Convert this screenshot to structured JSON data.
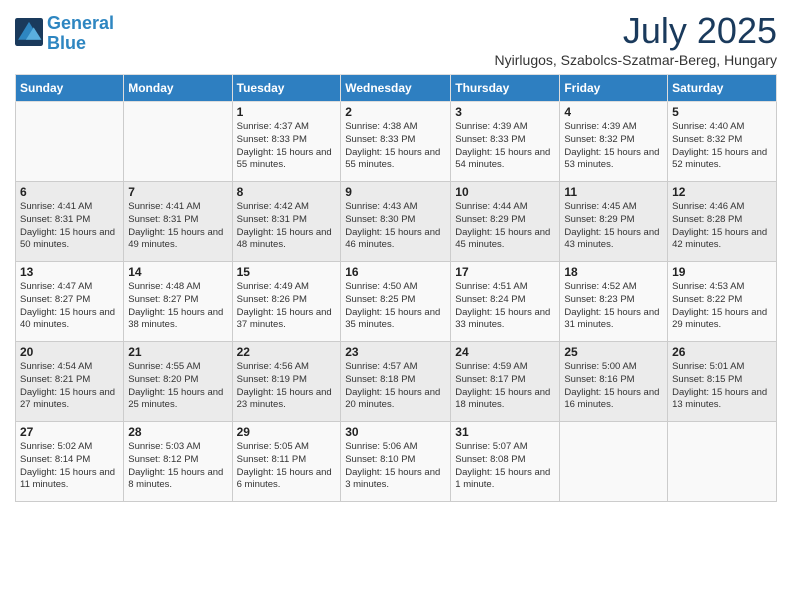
{
  "logo": {
    "line1": "General",
    "line2": "Blue"
  },
  "title": "July 2025",
  "location": "Nyirlugos, Szabolcs-Szatmar-Bereg, Hungary",
  "days_of_week": [
    "Sunday",
    "Monday",
    "Tuesday",
    "Wednesday",
    "Thursday",
    "Friday",
    "Saturday"
  ],
  "weeks": [
    [
      {
        "day": "",
        "sunrise": "",
        "sunset": "",
        "daylight": ""
      },
      {
        "day": "",
        "sunrise": "",
        "sunset": "",
        "daylight": ""
      },
      {
        "day": "1",
        "sunrise": "Sunrise: 4:37 AM",
        "sunset": "Sunset: 8:33 PM",
        "daylight": "Daylight: 15 hours and 55 minutes."
      },
      {
        "day": "2",
        "sunrise": "Sunrise: 4:38 AM",
        "sunset": "Sunset: 8:33 PM",
        "daylight": "Daylight: 15 hours and 55 minutes."
      },
      {
        "day": "3",
        "sunrise": "Sunrise: 4:39 AM",
        "sunset": "Sunset: 8:33 PM",
        "daylight": "Daylight: 15 hours and 54 minutes."
      },
      {
        "day": "4",
        "sunrise": "Sunrise: 4:39 AM",
        "sunset": "Sunset: 8:32 PM",
        "daylight": "Daylight: 15 hours and 53 minutes."
      },
      {
        "day": "5",
        "sunrise": "Sunrise: 4:40 AM",
        "sunset": "Sunset: 8:32 PM",
        "daylight": "Daylight: 15 hours and 52 minutes."
      }
    ],
    [
      {
        "day": "6",
        "sunrise": "Sunrise: 4:41 AM",
        "sunset": "Sunset: 8:31 PM",
        "daylight": "Daylight: 15 hours and 50 minutes."
      },
      {
        "day": "7",
        "sunrise": "Sunrise: 4:41 AM",
        "sunset": "Sunset: 8:31 PM",
        "daylight": "Daylight: 15 hours and 49 minutes."
      },
      {
        "day": "8",
        "sunrise": "Sunrise: 4:42 AM",
        "sunset": "Sunset: 8:31 PM",
        "daylight": "Daylight: 15 hours and 48 minutes."
      },
      {
        "day": "9",
        "sunrise": "Sunrise: 4:43 AM",
        "sunset": "Sunset: 8:30 PM",
        "daylight": "Daylight: 15 hours and 46 minutes."
      },
      {
        "day": "10",
        "sunrise": "Sunrise: 4:44 AM",
        "sunset": "Sunset: 8:29 PM",
        "daylight": "Daylight: 15 hours and 45 minutes."
      },
      {
        "day": "11",
        "sunrise": "Sunrise: 4:45 AM",
        "sunset": "Sunset: 8:29 PM",
        "daylight": "Daylight: 15 hours and 43 minutes."
      },
      {
        "day": "12",
        "sunrise": "Sunrise: 4:46 AM",
        "sunset": "Sunset: 8:28 PM",
        "daylight": "Daylight: 15 hours and 42 minutes."
      }
    ],
    [
      {
        "day": "13",
        "sunrise": "Sunrise: 4:47 AM",
        "sunset": "Sunset: 8:27 PM",
        "daylight": "Daylight: 15 hours and 40 minutes."
      },
      {
        "day": "14",
        "sunrise": "Sunrise: 4:48 AM",
        "sunset": "Sunset: 8:27 PM",
        "daylight": "Daylight: 15 hours and 38 minutes."
      },
      {
        "day": "15",
        "sunrise": "Sunrise: 4:49 AM",
        "sunset": "Sunset: 8:26 PM",
        "daylight": "Daylight: 15 hours and 37 minutes."
      },
      {
        "day": "16",
        "sunrise": "Sunrise: 4:50 AM",
        "sunset": "Sunset: 8:25 PM",
        "daylight": "Daylight: 15 hours and 35 minutes."
      },
      {
        "day": "17",
        "sunrise": "Sunrise: 4:51 AM",
        "sunset": "Sunset: 8:24 PM",
        "daylight": "Daylight: 15 hours and 33 minutes."
      },
      {
        "day": "18",
        "sunrise": "Sunrise: 4:52 AM",
        "sunset": "Sunset: 8:23 PM",
        "daylight": "Daylight: 15 hours and 31 minutes."
      },
      {
        "day": "19",
        "sunrise": "Sunrise: 4:53 AM",
        "sunset": "Sunset: 8:22 PM",
        "daylight": "Daylight: 15 hours and 29 minutes."
      }
    ],
    [
      {
        "day": "20",
        "sunrise": "Sunrise: 4:54 AM",
        "sunset": "Sunset: 8:21 PM",
        "daylight": "Daylight: 15 hours and 27 minutes."
      },
      {
        "day": "21",
        "sunrise": "Sunrise: 4:55 AM",
        "sunset": "Sunset: 8:20 PM",
        "daylight": "Daylight: 15 hours and 25 minutes."
      },
      {
        "day": "22",
        "sunrise": "Sunrise: 4:56 AM",
        "sunset": "Sunset: 8:19 PM",
        "daylight": "Daylight: 15 hours and 23 minutes."
      },
      {
        "day": "23",
        "sunrise": "Sunrise: 4:57 AM",
        "sunset": "Sunset: 8:18 PM",
        "daylight": "Daylight: 15 hours and 20 minutes."
      },
      {
        "day": "24",
        "sunrise": "Sunrise: 4:59 AM",
        "sunset": "Sunset: 8:17 PM",
        "daylight": "Daylight: 15 hours and 18 minutes."
      },
      {
        "day": "25",
        "sunrise": "Sunrise: 5:00 AM",
        "sunset": "Sunset: 8:16 PM",
        "daylight": "Daylight: 15 hours and 16 minutes."
      },
      {
        "day": "26",
        "sunrise": "Sunrise: 5:01 AM",
        "sunset": "Sunset: 8:15 PM",
        "daylight": "Daylight: 15 hours and 13 minutes."
      }
    ],
    [
      {
        "day": "27",
        "sunrise": "Sunrise: 5:02 AM",
        "sunset": "Sunset: 8:14 PM",
        "daylight": "Daylight: 15 hours and 11 minutes."
      },
      {
        "day": "28",
        "sunrise": "Sunrise: 5:03 AM",
        "sunset": "Sunset: 8:12 PM",
        "daylight": "Daylight: 15 hours and 8 minutes."
      },
      {
        "day": "29",
        "sunrise": "Sunrise: 5:05 AM",
        "sunset": "Sunset: 8:11 PM",
        "daylight": "Daylight: 15 hours and 6 minutes."
      },
      {
        "day": "30",
        "sunrise": "Sunrise: 5:06 AM",
        "sunset": "Sunset: 8:10 PM",
        "daylight": "Daylight: 15 hours and 3 minutes."
      },
      {
        "day": "31",
        "sunrise": "Sunrise: 5:07 AM",
        "sunset": "Sunset: 8:08 PM",
        "daylight": "Daylight: 15 hours and 1 minute."
      },
      {
        "day": "",
        "sunrise": "",
        "sunset": "",
        "daylight": ""
      },
      {
        "day": "",
        "sunrise": "",
        "sunset": "",
        "daylight": ""
      }
    ]
  ]
}
